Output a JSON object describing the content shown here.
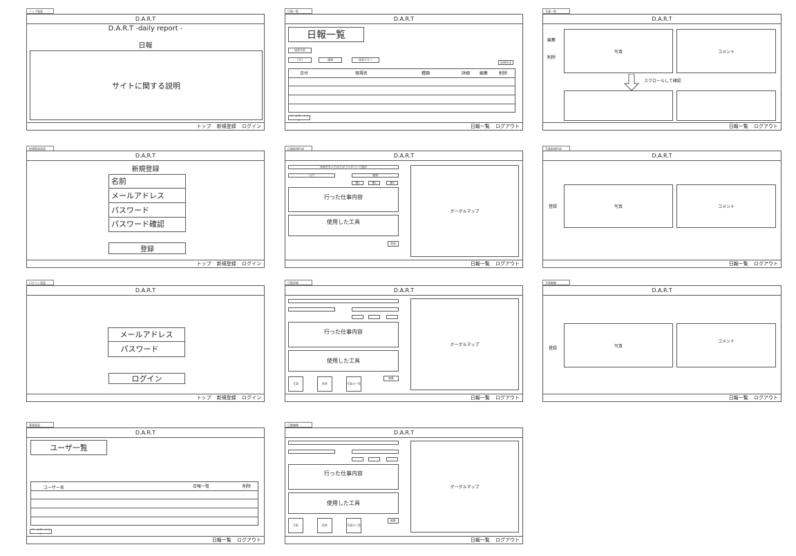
{
  "common": {
    "app": "D.A.R.T",
    "nav_top": "トップ",
    "nav_register": "新規登録",
    "nav_login": "ログイン",
    "nav_reports": "日報一覧",
    "nav_logout": "ログアウト"
  },
  "screen_top": {
    "tag": "トップ画面",
    "title": "D.A.R.T -daily report -",
    "subtitle": "日報",
    "desc": "サイトに関する説明"
  },
  "screen_list": {
    "tag": "日報一覧",
    "title": "日報一覧",
    "filter1": "検索内容",
    "filter2": "日付",
    "filter3": "種類",
    "filter4": "検索ボタン",
    "btn_right": "新規作成",
    "columns": [
      "日付",
      "現場名",
      "種類",
      "詳細",
      "編集",
      "削除"
    ],
    "pager": "ページネーション"
  },
  "screen_photos": {
    "tag": "写真一覧",
    "edit": "編集",
    "delete": "削除",
    "photo": "写真",
    "comment": "コメント",
    "scroll": "スクロールして確認"
  },
  "screen_signup": {
    "tag": "新規登録画面",
    "title": "新規登録",
    "name": "名前",
    "email": "メールアドレス",
    "password": "パスワード",
    "password_confirm": "パスワード確認",
    "submit": "登録"
  },
  "screen_create": {
    "tag": "日報新規作成",
    "site": "現場名を入力またはプルダウンで選択",
    "date": "日付",
    "kind": "種類",
    "chip1": "種1",
    "chip2": "種2",
    "chip3": "種3",
    "work": "行った仕事内容",
    "tools": "使用した工具",
    "save": "登録",
    "map": "グーグルマップ"
  },
  "screen_photo_create": {
    "tag": "写真新規作成",
    "register": "登録",
    "photo": "写真",
    "comment": "コメント"
  },
  "screen_login": {
    "tag": "ログイン画面",
    "email": "メールアドレス",
    "password": "パスワード",
    "submit": "ログイン"
  },
  "screen_detail": {
    "tag": "日報詳細",
    "work": "行った仕事内容",
    "tools": "使用した工具",
    "edit": "編集",
    "photo": "写真",
    "delete": "削除",
    "photo_list": "写真の一覧",
    "map": "グーグルマップ"
  },
  "screen_photo_edit": {
    "tag": "写真編集",
    "register": "登録",
    "photo": "写真",
    "comment": "コメント"
  },
  "screen_admin": {
    "tag": "管理画面",
    "title": "ユーザ一覧",
    "col_user": "ユーザー名",
    "col_reports": "日報一覧",
    "col_delete": "削除",
    "pager": "ページネーション"
  },
  "screen_edit": {
    "tag": "日報編集",
    "work": "行った仕事内容",
    "tools": "使用した工具",
    "save": "編集",
    "photo": "写真",
    "delete": "削除",
    "photo_list": "写真の一覧",
    "map": "グーグルマップ"
  }
}
